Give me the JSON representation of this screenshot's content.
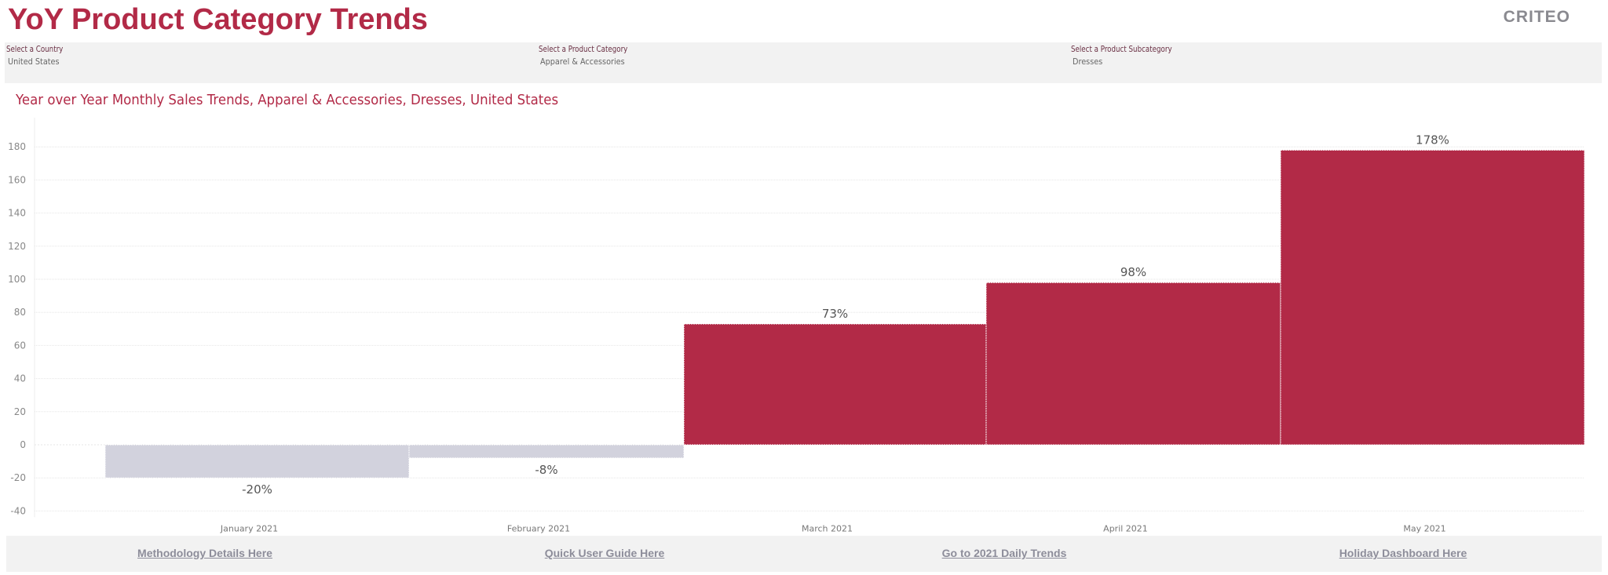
{
  "header": {
    "title": "YoY Product Category Trends",
    "logo_text": "CRITEO"
  },
  "filters": [
    {
      "label": "Select a Country",
      "value": "United States"
    },
    {
      "label": "Select a Product Category",
      "value": "Apparel & Accessories"
    },
    {
      "label": "Select a Product Subcategory",
      "value": "Dresses"
    }
  ],
  "footer": {
    "links": [
      {
        "label": "Methodology Details Here"
      },
      {
        "label": "Quick User Guide Here"
      },
      {
        "label": "Go to 2021 Daily Trends"
      },
      {
        "label": "Holiday Dashboard Here"
      }
    ]
  },
  "colors": {
    "accent": "#B22A47",
    "positive_bar": "#B22A47",
    "negative_bar": "#D2D2DD",
    "gridline": "#e6e6e6"
  },
  "chart_data": {
    "type": "bar",
    "title": "Year over Year Monthly Sales Trends, Apparel & Accessories,  Dresses, United States",
    "xlabel": "",
    "ylabel": "",
    "categories": [
      "January 2021",
      "February 2021",
      "March 2021",
      "April 2021",
      "May 2021"
    ],
    "values": [
      -20,
      -8,
      73,
      98,
      178
    ],
    "data_labels": [
      "-20%",
      "-8%",
      "73%",
      "98%",
      "178%"
    ],
    "relative_widths": [
      387,
      350,
      385,
      375,
      387
    ],
    "ylim": [
      -40,
      190
    ],
    "yticks": [
      -40,
      -20,
      0,
      20,
      40,
      60,
      80,
      100,
      120,
      140,
      160,
      180
    ],
    "grid": true,
    "legend": "none"
  }
}
